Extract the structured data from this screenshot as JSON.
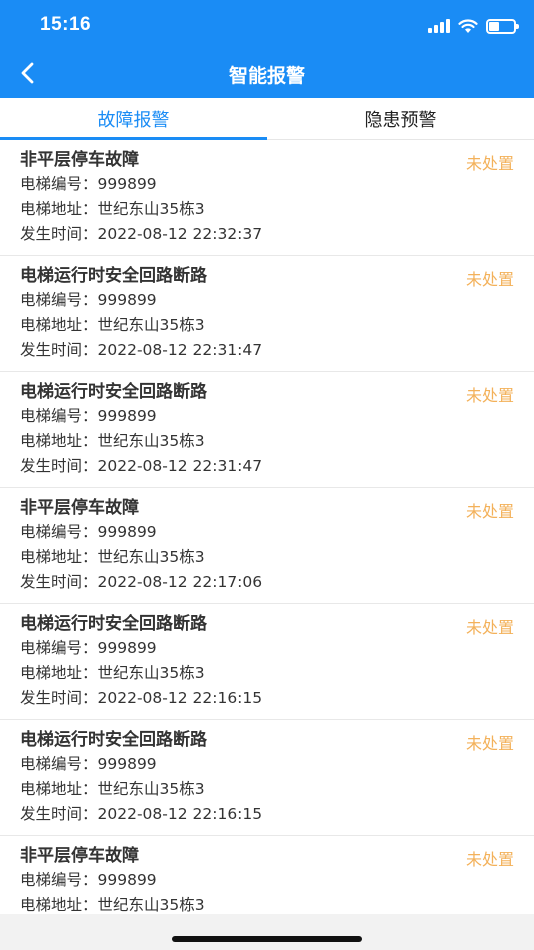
{
  "status_bar": {
    "time": "15:16",
    "battery_level": 0.4
  },
  "header": {
    "title": "智能报警",
    "back_icon": "chevron-left-icon"
  },
  "tabs": [
    {
      "label": "故障报警",
      "active": true
    },
    {
      "label": "隐患预警",
      "active": false
    }
  ],
  "colors": {
    "primary": "#1a8cf5",
    "status_pending": "#f3b15a"
  },
  "alarms": [
    {
      "title": "非平层停车故障",
      "status": "未处置",
      "elevator_no": "电梯编号：999899",
      "address": "电梯地址：世纪东山35栋3",
      "time": "发生时间：2022-08-12 22:32:37"
    },
    {
      "title": "电梯运行时安全回路断路",
      "status": "未处置",
      "elevator_no": "电梯编号：999899",
      "address": "电梯地址：世纪东山35栋3",
      "time": "发生时间：2022-08-12 22:31:47"
    },
    {
      "title": "电梯运行时安全回路断路",
      "status": "未处置",
      "elevator_no": "电梯编号：999899",
      "address": "电梯地址：世纪东山35栋3",
      "time": "发生时间：2022-08-12 22:31:47"
    },
    {
      "title": "非平层停车故障",
      "status": "未处置",
      "elevator_no": "电梯编号：999899",
      "address": "电梯地址：世纪东山35栋3",
      "time": "发生时间：2022-08-12 22:17:06"
    },
    {
      "title": "电梯运行时安全回路断路",
      "status": "未处置",
      "elevator_no": "电梯编号：999899",
      "address": "电梯地址：世纪东山35栋3",
      "time": "发生时间：2022-08-12 22:16:15"
    },
    {
      "title": "电梯运行时安全回路断路",
      "status": "未处置",
      "elevator_no": "电梯编号：999899",
      "address": "电梯地址：世纪东山35栋3",
      "time": "发生时间：2022-08-12 22:16:15"
    },
    {
      "title": "非平层停车故障",
      "status": "未处置",
      "elevator_no": "电梯编号：999899",
      "address": "电梯地址：世纪东山35栋3",
      "time": ""
    }
  ]
}
